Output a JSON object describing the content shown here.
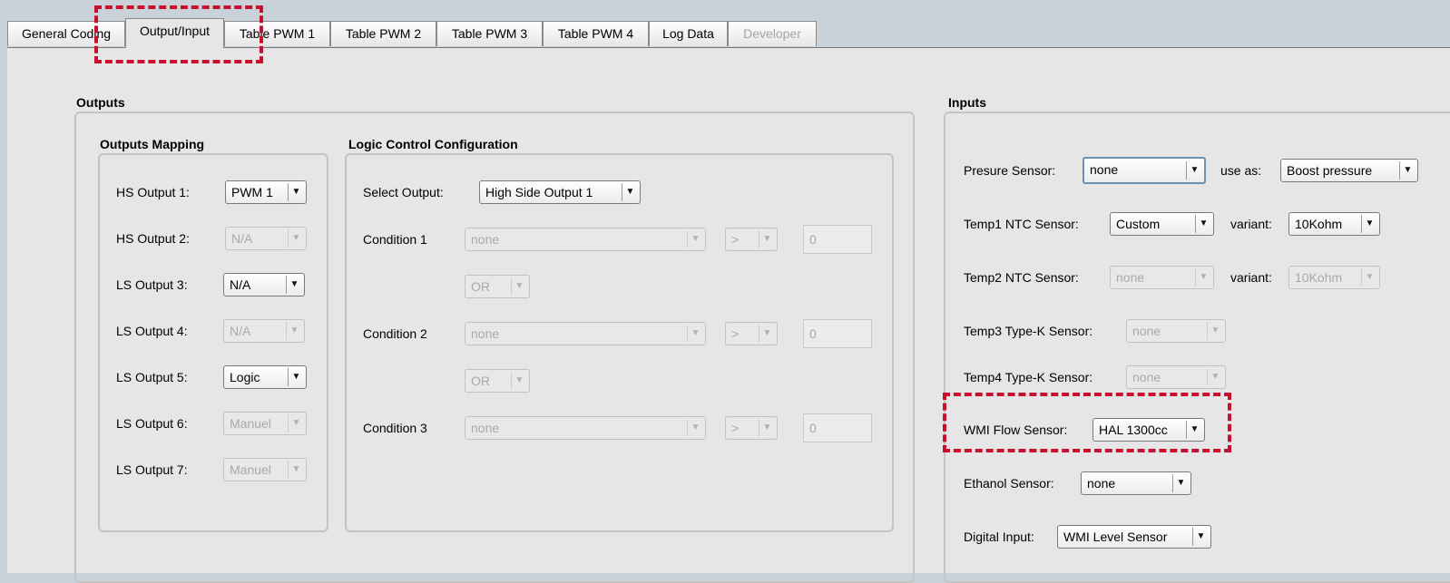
{
  "tabs": [
    "General Coding",
    "Output/Input",
    "Table PWM 1",
    "Table PWM 2",
    "Table PWM 3",
    "Table PWM 4",
    "Log Data",
    "Developer"
  ],
  "outputs": {
    "title": "Outputs",
    "mapping": {
      "title": "Outputs Mapping",
      "rows": [
        {
          "label": "HS Output 1:",
          "value": "PWM 1"
        },
        {
          "label": "HS Output 2:",
          "value": "N/A"
        },
        {
          "label": "LS Output 3:",
          "value": "N/A"
        },
        {
          "label": "LS Output 4:",
          "value": "N/A"
        },
        {
          "label": "LS Output 5:",
          "value": "Logic"
        },
        {
          "label": "LS Output 6:",
          "value": "Manuel"
        },
        {
          "label": "LS Output 7:",
          "value": "Manuel"
        }
      ]
    },
    "logic": {
      "title": "Logic Control Configuration",
      "select_output_label": "Select Output:",
      "select_output_value": "High Side Output 1",
      "conditions": [
        {
          "label": "Condition 1",
          "value": "none",
          "op": ">",
          "number": "0"
        },
        {
          "label": "Condition 2",
          "value": "none",
          "op": ">",
          "number": "0"
        },
        {
          "label": "Condition 3",
          "value": "none",
          "op": ">",
          "number": "0"
        }
      ],
      "joiners": [
        "OR",
        "OR"
      ]
    }
  },
  "inputs": {
    "title": "Inputs",
    "pressure": {
      "label": "Presure Sensor:",
      "value": "none",
      "use_as_label": "use as:",
      "use_as_value": "Boost pressure"
    },
    "temp1": {
      "label": "Temp1 NTC Sensor:",
      "value": "Custom",
      "variant_label": "variant:",
      "variant_value": "10Kohm"
    },
    "temp2": {
      "label": "Temp2 NTC Sensor:",
      "value": "none",
      "variant_label": "variant:",
      "variant_value": "10Kohm"
    },
    "temp3": {
      "label": "Temp3 Type-K Sensor:",
      "value": "none"
    },
    "temp4": {
      "label": "Temp4 Type-K Sensor:",
      "value": "none"
    },
    "wmi": {
      "label": "WMI Flow Sensor:",
      "value": "HAL 1300cc"
    },
    "ethanol": {
      "label": "Ethanol Sensor:",
      "value": "none"
    },
    "digital": {
      "label": "Digital Input:",
      "value": "WMI Level Sensor"
    }
  },
  "icons": {
    "dropdown": "triangle-down-icon"
  },
  "colors": {
    "highlight": "#c8102e",
    "focus": "#6d8fb3"
  }
}
